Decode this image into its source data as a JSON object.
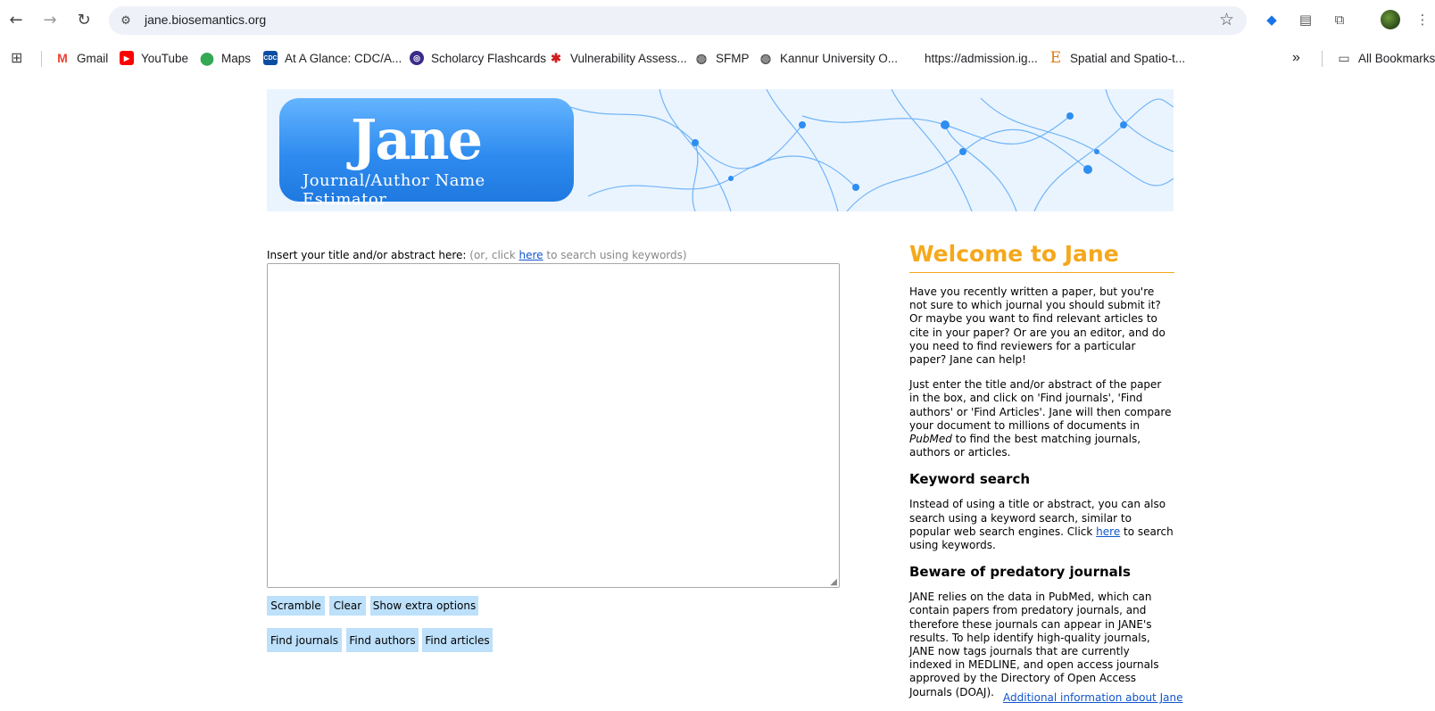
{
  "browser": {
    "url": "jane.biosemantics.org",
    "bookmarks": [
      {
        "label": "Gmail"
      },
      {
        "label": "YouTube"
      },
      {
        "label": "Maps"
      },
      {
        "label": "At A Glance: CDC/A..."
      },
      {
        "label": "Scholarcy Flashcards"
      },
      {
        "label": "Vulnerability Assess..."
      },
      {
        "label": "SFMP"
      },
      {
        "label": "Kannur University O..."
      },
      {
        "label": "https://admission.ig..."
      },
      {
        "label": "Spatial and Spatio-t..."
      }
    ],
    "overflow_label": "»",
    "all_bookmarks": "All Bookmarks"
  },
  "banner": {
    "logo_big": "Jane",
    "logo_sub": "Journal/Author Name Estimator"
  },
  "form": {
    "label": "Insert your title and/or abstract here:",
    "hint_prefix": "(or, click",
    "hint_link": "here",
    "hint_suffix": "to search using keywords)",
    "buttons_row1": [
      "Scramble",
      "Clear",
      "Show extra options"
    ],
    "buttons_row2": [
      "Find journals",
      "Find authors",
      "Find articles"
    ]
  },
  "sidebar": {
    "title": "Welcome to Jane",
    "intro": "Have you recently written a paper, but you're not sure to which journal you should submit it? Or maybe you want to find relevant articles to cite in your paper? Or are you an editor, and do you need to find reviewers for a particular paper? Jane can help!",
    "p2_before": "Just enter the title and/or abstract of the paper in the box, and click on 'Find journals', 'Find authors' or 'Find Articles'. Jane will then compare your document to millions of documents in",
    "p2_em": "PubMed",
    "p2_after": "to find the best matching journals, authors or articles.",
    "kw_title": "Keyword search",
    "kw_before": "Instead of using a title or abstract, you can also search using a keyword search, similar to popular web search engines. Click",
    "kw_link": "here",
    "kw_after": "to search using keywords.",
    "pred_title": "Beware of predatory journals",
    "pred_text": "JANE relies on the data in PubMed, which can contain papers from predatory journals, and therefore these journals can appear in JANE's results. To help identify high-quality journals, JANE now tags journals that are currently indexed in MEDLINE, and open access journals approved by the Directory of Open Access Journals (DOAJ).",
    "more_link": "Additional information about Jane"
  }
}
